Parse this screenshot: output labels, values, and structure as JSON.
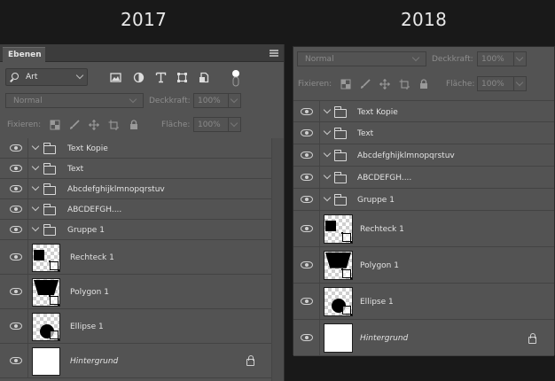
{
  "years": {
    "left": "2017",
    "right": "2018"
  },
  "panel2017": {
    "tab_label": "Ebenen",
    "filter": {
      "label": "Art",
      "icons": [
        "image-filter-icon",
        "adjustment-filter-icon",
        "type-filter-icon",
        "shape-filter-icon",
        "smartobject-filter-icon",
        "filter-toggle-icon"
      ]
    },
    "blend_mode": "Normal",
    "opacity_label": "Deckkraft:",
    "opacity_value": "100%",
    "lock_label": "Fixieren:",
    "lock_icons": [
      "lock-transparent-icon",
      "lock-brush-icon",
      "lock-move-icon",
      "lock-artboard-icon",
      "lock-all-icon"
    ],
    "fill_label": "Fläche:",
    "fill_value": "100%",
    "layers": [
      {
        "name": "Text Kopie",
        "kind": "group"
      },
      {
        "name": "Text",
        "kind": "group"
      },
      {
        "name": "Abcdefghijklmnopqrstuv",
        "kind": "group"
      },
      {
        "name": "ABCDEFGH....",
        "kind": "group"
      },
      {
        "name": "Gruppe 1",
        "kind": "group"
      },
      {
        "name": "Rechteck 1",
        "kind": "shape-rect"
      },
      {
        "name": "Polygon 1",
        "kind": "shape-poly"
      },
      {
        "name": "Ellipse 1",
        "kind": "shape-ellipse"
      },
      {
        "name": "Hintergrund",
        "kind": "background",
        "locked": true
      }
    ]
  },
  "panel2018": {
    "blend_mode": "Normal",
    "opacity_label": "Deckkraft:",
    "opacity_value": "100%",
    "lock_label": "Fixieren:",
    "fill_label": "Fläche:",
    "fill_value": "100%",
    "layers": [
      {
        "name": "Text Kopie",
        "kind": "group"
      },
      {
        "name": "Text",
        "kind": "group"
      },
      {
        "name": "Abcdefghijklmnopqrstuv",
        "kind": "group"
      },
      {
        "name": "ABCDEFGH....",
        "kind": "group"
      },
      {
        "name": "Gruppe 1",
        "kind": "group"
      },
      {
        "name": "Rechteck 1",
        "kind": "shape-rect"
      },
      {
        "name": "Polygon 1",
        "kind": "shape-poly"
      },
      {
        "name": "Ellipse 1",
        "kind": "shape-ellipse"
      },
      {
        "name": "Hintergrund",
        "kind": "background",
        "locked": true
      }
    ]
  },
  "colors": {
    "page_bg": "#191919",
    "panel_bg": "#535353",
    "text": "#e2e2e2",
    "muted": "#8d8d8d"
  }
}
